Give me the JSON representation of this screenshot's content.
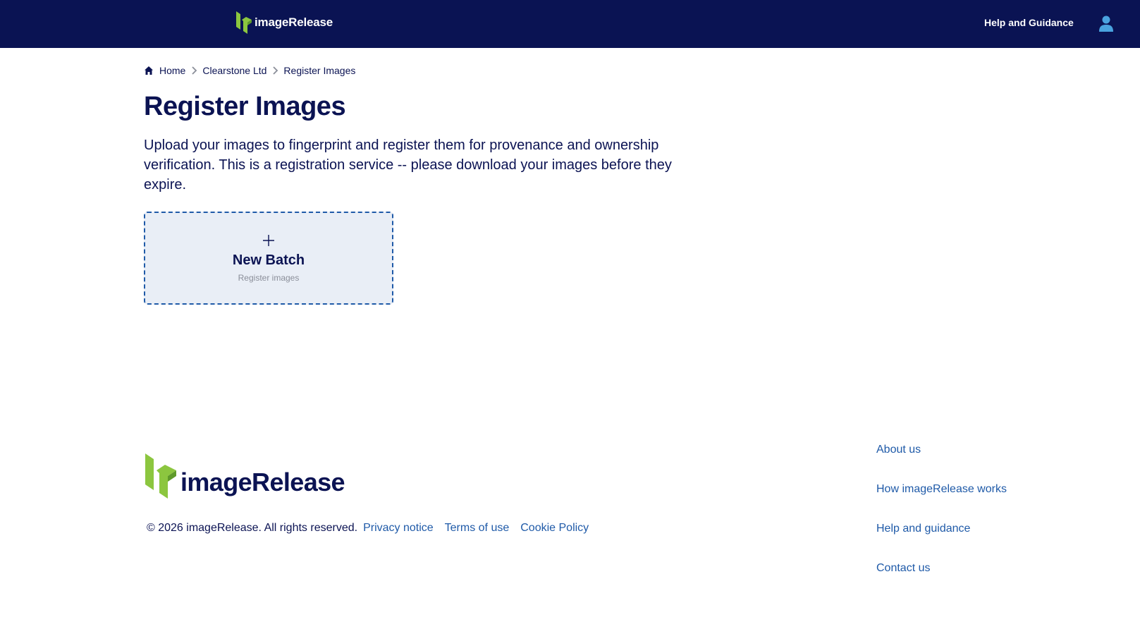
{
  "header": {
    "brand": "imageRelease",
    "help_label": "Help and Guidance",
    "user_icon": "user-icon"
  },
  "breadcrumb": {
    "items": [
      "Home",
      "Clearstone Ltd",
      "Register Images"
    ]
  },
  "main": {
    "title": "Register Images",
    "intro": "Upload your images to fingerprint and register them for provenance and ownership verification. This is a registration service -- please download your images before they expire.",
    "new_batch": {
      "title": "New Batch",
      "subtitle": "Register images",
      "icon": "plus-icon"
    }
  },
  "footer": {
    "brand": "imageRelease",
    "copyright": "© 2026 imageRelease. All rights reserved.",
    "legal_links": [
      "Privacy notice",
      "Terms of use",
      "Cookie Policy"
    ],
    "links": [
      "About us",
      "How imageRelease works",
      "Help and guidance",
      "Contact us"
    ]
  },
  "colors": {
    "navy": "#0a1353",
    "link_blue": "#1f5aa8",
    "logo_green": "#8cc63f",
    "accent_light_blue": "#4aa3df",
    "card_bg": "#e9eef6"
  }
}
